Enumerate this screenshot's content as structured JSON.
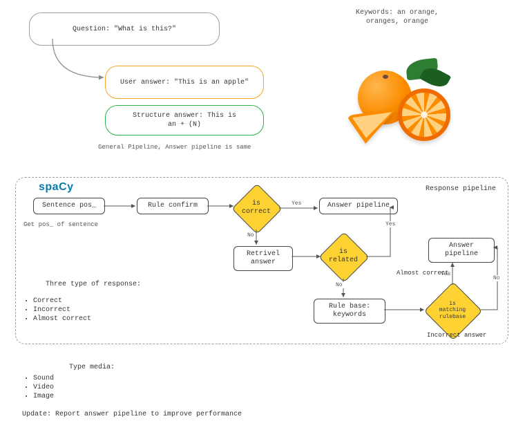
{
  "bubbles": {
    "question": "Question: \"What is this?\"",
    "user_answer": "User answer: \"This is an apple\"",
    "structure_answer_line1": "Structure answer: This is",
    "structure_answer_line2": "an + (N)"
  },
  "keywords_label_line1": "Keywords: an orange,",
  "keywords_label_line2": "oranges, orange",
  "general_caption": "General Pipeline, Answer pipeline is same",
  "panel_title": "Response pipeline",
  "spacy": "spaCy",
  "nodes": {
    "sentence_pos": "Sentence pos_",
    "rule_confirm": "Rule confirm",
    "answer_pipeline_top": "Answer pipeline",
    "retrieval_answer": "Retrivel answer",
    "rule_base_keywords_line1": "Rule base:",
    "rule_base_keywords_line2": "keywords",
    "answer_pipeline_right": "Answer pipeline"
  },
  "decisions": {
    "is_correct_line1": "is",
    "is_correct_line2": "correct",
    "is_related_line1": "is",
    "is_related_line2": "related",
    "is_matching_line1": "is matching",
    "is_matching_line2": "rulebase"
  },
  "edge_labels": {
    "yes_top": "Yes",
    "no_vert": "No",
    "no_vert2": "No",
    "yes_mid": "Yes",
    "yes_right": "Yes",
    "no_right": "No",
    "almost_correct": "Almost correct",
    "incorrect_answer": "Incorrect answer"
  },
  "pos_caption": "Get pos_ of sentence",
  "response_types_title": "Three type of response:",
  "response_types": [
    "Correct",
    "Incorrect",
    "Almost correct"
  ],
  "type_media_title": "Type media:",
  "type_media": [
    "Sound",
    "Video",
    "Image"
  ],
  "update_note": "Update: Report answer pipeline to improve performance"
}
